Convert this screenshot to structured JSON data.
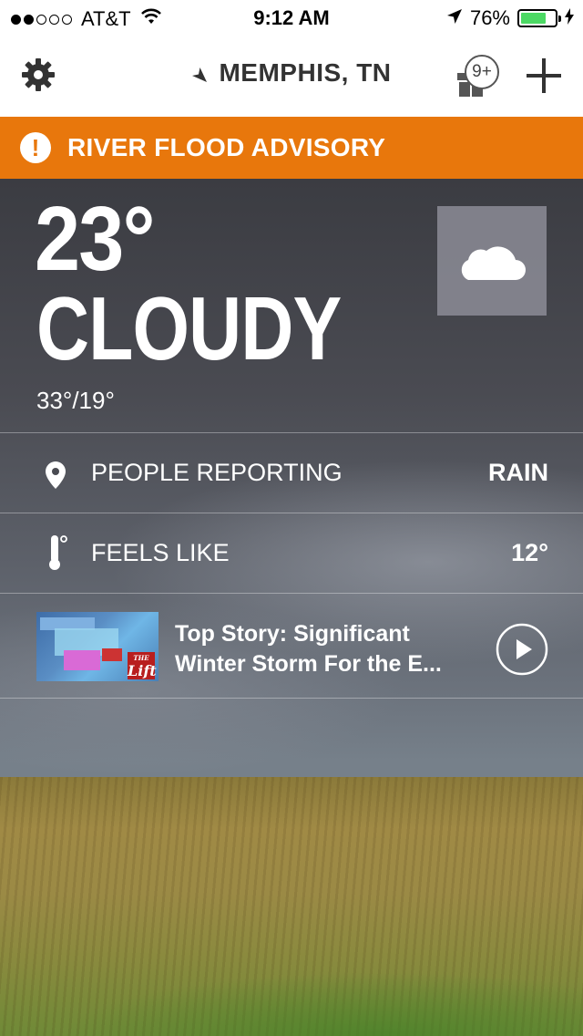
{
  "status_bar": {
    "carrier": "AT&T",
    "signal_bars_filled": 2,
    "signal_bars_total": 5,
    "time": "9:12 AM",
    "battery_percent": "76%",
    "battery_level": 0.76,
    "battery_color": "#4cd964"
  },
  "nav": {
    "settings_icon": "gear-icon",
    "location": "MEMPHIS, TN",
    "gift_badge": "9+",
    "add_icon": "plus-icon"
  },
  "advisory": {
    "text": "RIVER FLOOD ADVISORY",
    "color": "#e8770c"
  },
  "current": {
    "temperature": "23°",
    "condition": "CLOUDY",
    "hi_lo": "33°/19°",
    "icon": "cloud-icon"
  },
  "rows": {
    "reporting": {
      "label": "PEOPLE REPORTING",
      "value": "RAIN"
    },
    "feels_like": {
      "label": "FEELS LIKE",
      "value": "12°"
    }
  },
  "story": {
    "title_line1": "Top Story: Significant",
    "title_line2": "Winter Storm For the E...",
    "thumb_logo": "Lift",
    "thumb_logo_prefix": "THE"
  }
}
